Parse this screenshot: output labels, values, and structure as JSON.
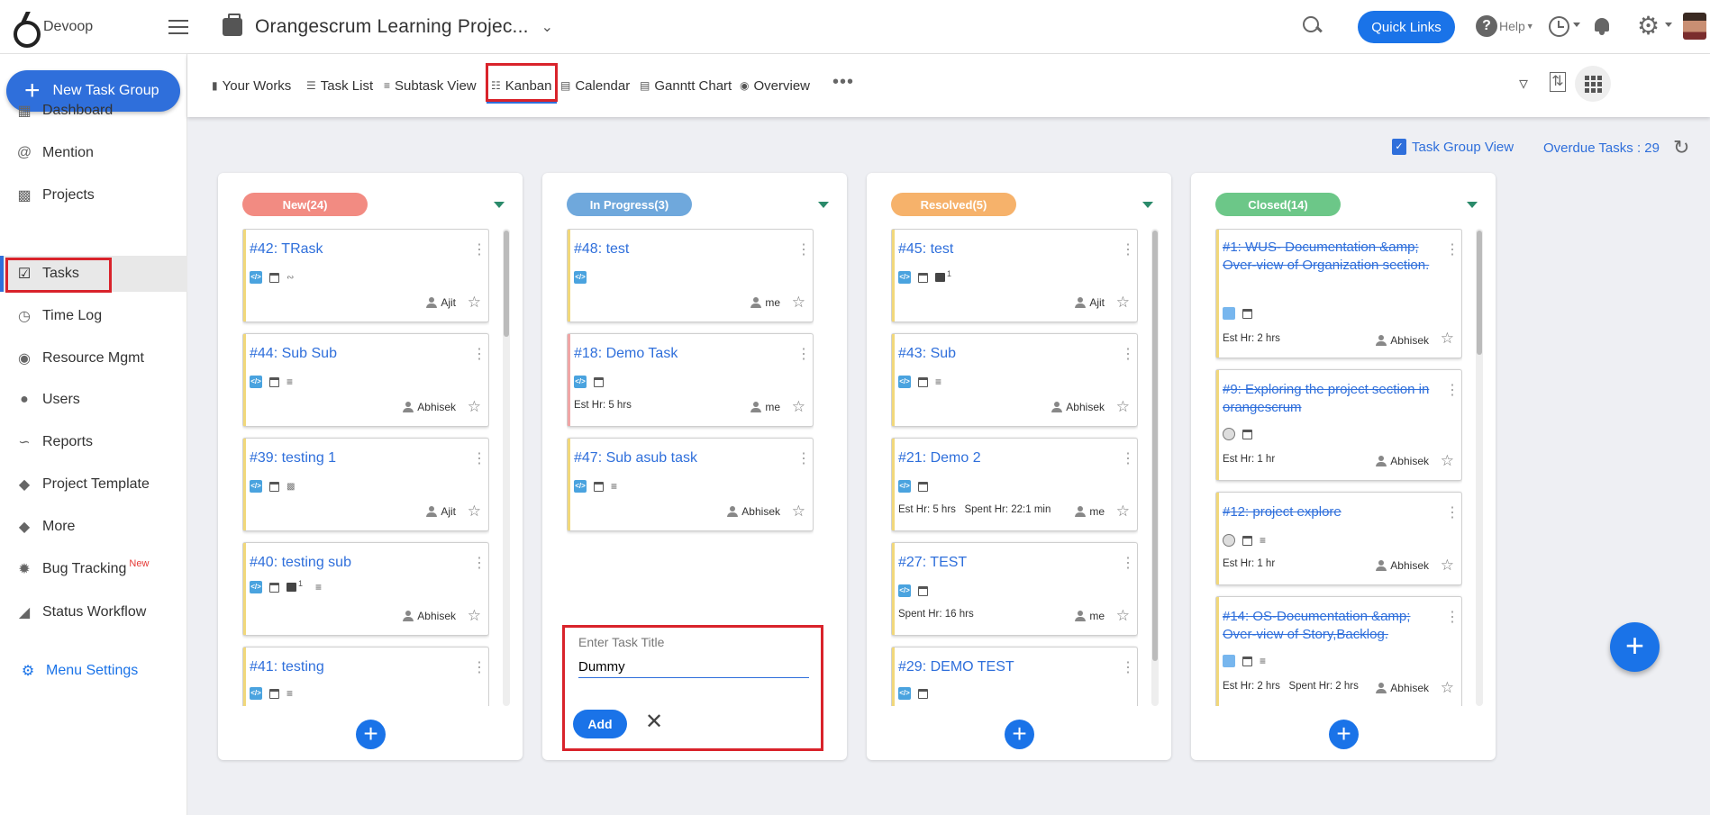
{
  "app": {
    "name": "Devoop"
  },
  "header": {
    "project_title": "Orangescrum Learning Projec...",
    "quick_links": "Quick Links",
    "help": "Help"
  },
  "sidebar": {
    "new_task_group": "New Task Group",
    "items": [
      {
        "label": "Dashboard",
        "icon": "dashboard-icon"
      },
      {
        "label": "Mention",
        "icon": "at-icon"
      },
      {
        "label": "Projects",
        "icon": "briefcase-icon"
      },
      {
        "label": "Tasks",
        "icon": "clipboard-check-icon"
      },
      {
        "label": "Time Log",
        "icon": "clock-icon"
      },
      {
        "label": "Resource Mgmt",
        "icon": "palette-icon"
      },
      {
        "label": "Users",
        "icon": "user-icon"
      },
      {
        "label": "Reports",
        "icon": "trend-icon"
      },
      {
        "label": "Project Template",
        "icon": "layers-icon"
      },
      {
        "label": "More",
        "icon": "layers-icon"
      },
      {
        "label": "Bug Tracking",
        "icon": "bug-icon",
        "badge": "New"
      },
      {
        "label": "Status Workflow",
        "icon": "workflow-icon"
      }
    ],
    "menu_settings": "Menu Settings"
  },
  "views": {
    "tabs": [
      "Your Works",
      "Task List",
      "Subtask View",
      "Kanban",
      "Calendar",
      "Ganntt Chart",
      "Overview"
    ],
    "active": "Kanban"
  },
  "toolbar": {
    "task_group_view": "Task Group View",
    "overdue": "Overdue Tasks : 29"
  },
  "columns": [
    {
      "label": "New(24)",
      "color": "#f28b82",
      "cards": [
        {
          "title": "#42: TRask",
          "user": "Ajit",
          "est": ""
        },
        {
          "title": "#44: Sub Sub",
          "user": "Abhisek",
          "est": ""
        },
        {
          "title": "#39: testing 1",
          "user": "Ajit",
          "est": ""
        },
        {
          "title": "#40: testing sub",
          "user": "Abhisek",
          "est": "",
          "comments": "1"
        },
        {
          "title": "#41: testing",
          "user": "",
          "est": ""
        }
      ]
    },
    {
      "label": "In Progress(3)",
      "color": "#6fa8dc",
      "cards": [
        {
          "title": "#48: test",
          "user": "me",
          "est": ""
        },
        {
          "title": "#18: Demo Task",
          "user": "me",
          "est": "Est Hr: 5 hrs"
        },
        {
          "title": "#47: Sub asub task",
          "user": "Abhisek",
          "est": ""
        }
      ]
    },
    {
      "label": "Resolved(5)",
      "color": "#f6b26b",
      "cards": [
        {
          "title": "#45: test",
          "user": "Ajit",
          "est": "",
          "comments": "1"
        },
        {
          "title": "#43: Sub",
          "user": "Abhisek",
          "est": ""
        },
        {
          "title": "#21: Demo 2",
          "user": "me",
          "est": "Est Hr: 5 hrs   Spent Hr: 22:1 min"
        },
        {
          "title": "#27: TEST",
          "user": "me",
          "est": "Spent Hr: 16 hrs"
        },
        {
          "title": "#29: DEMO TEST",
          "user": "",
          "est": ""
        }
      ]
    },
    {
      "label": "Closed(14)",
      "color": "#6cc788",
      "cards": [
        {
          "title": "#1: WUS- Documentation &amp; Over-view of Organization section.",
          "user": "Abhisek",
          "est": "Est Hr: 2 hrs"
        },
        {
          "title": "#9: Exploring the project section in orangescrum",
          "user": "Abhisek",
          "est": "Est Hr: 1 hr"
        },
        {
          "title": "#12: project explore",
          "user": "Abhisek",
          "est": "Est Hr: 1 hr"
        },
        {
          "title": "#14: OS-Documentation &amp; Over-view of Story,Backlog.",
          "user": "Abhisek",
          "est": "Est Hr: 2 hrs   Spent Hr: 2 hrs"
        }
      ]
    }
  ],
  "quick_add": {
    "label": "Enter Task Title",
    "value": "Dummy",
    "add_label": "Add"
  }
}
